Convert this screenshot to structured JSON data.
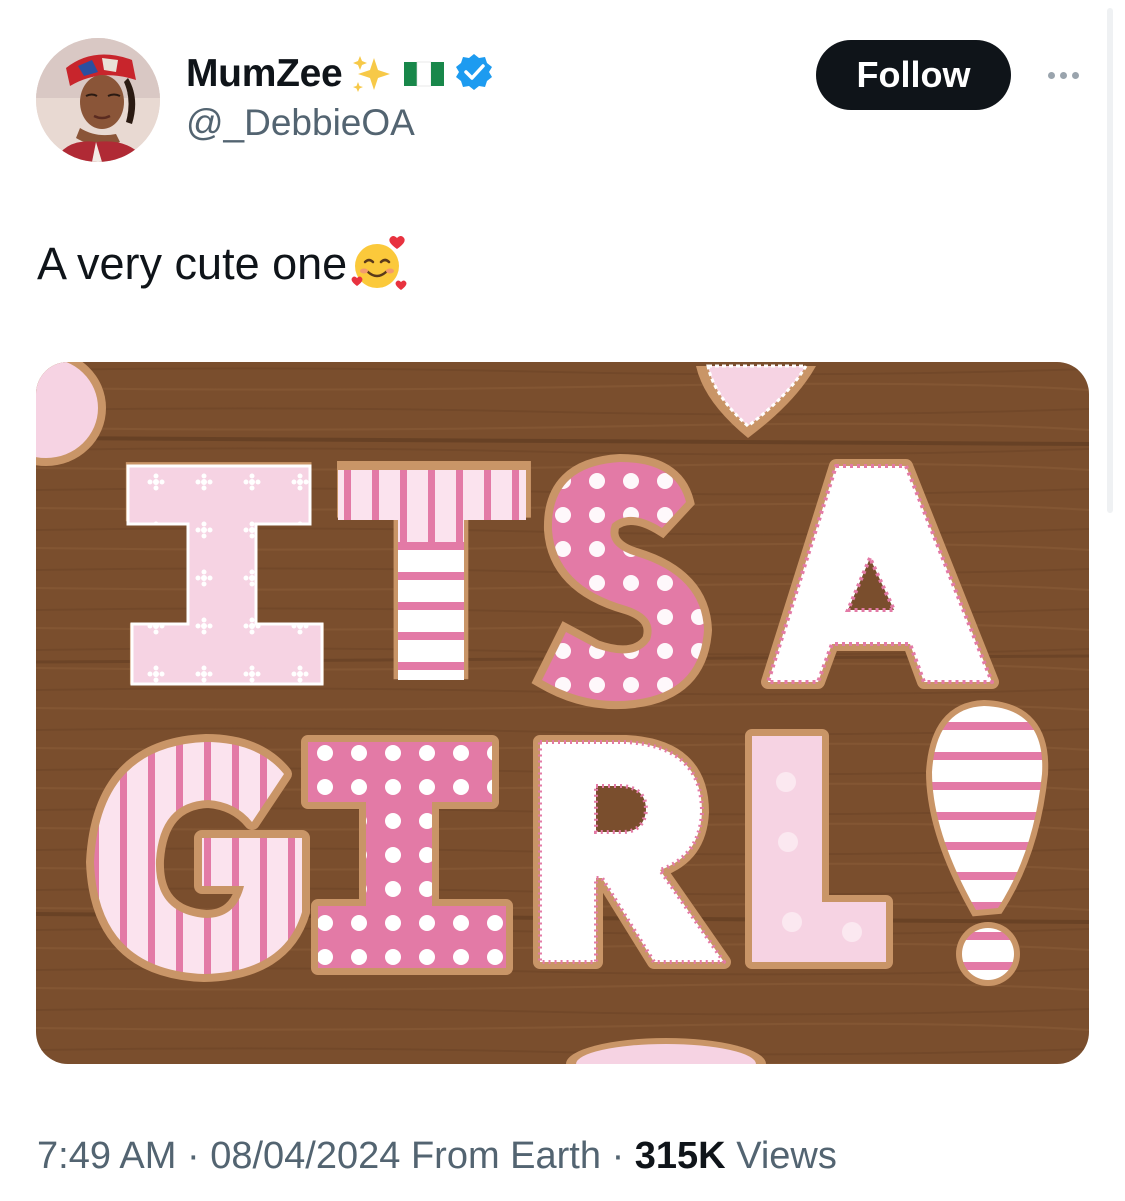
{
  "tweet": {
    "author": {
      "display_name": "MumZee",
      "handle": "@_DebbieOA",
      "name_badges": [
        "sparkles-emoji",
        "nigeria-flag-emoji",
        "verified-badge-icon"
      ]
    },
    "follow_label": "Follow",
    "more_icon": "more-horizontal-icon",
    "text": "A very cute one",
    "text_emoji": "smiling-face-with-hearts-emoji",
    "media": {
      "letters_line1": [
        "I",
        "T",
        "S",
        "A"
      ],
      "letters_line2": [
        "G",
        "I",
        "R",
        "L",
        "!"
      ],
      "colors": {
        "wood": "#7a4e2d",
        "pink": "#e37aa6",
        "light_pink": "#f6d3e3",
        "white": "#ffffff",
        "cookie_edge": "#c99567"
      }
    },
    "time": "7:49 AM",
    "separator": "·",
    "date": "08/04/2024",
    "source": "From Earth",
    "views_count": "315K",
    "views_label": "Views"
  },
  "colors": {
    "text_primary": "#0f1419",
    "text_secondary": "#536471",
    "verified": "#1d9bf0",
    "button_bg": "#0f1419"
  }
}
